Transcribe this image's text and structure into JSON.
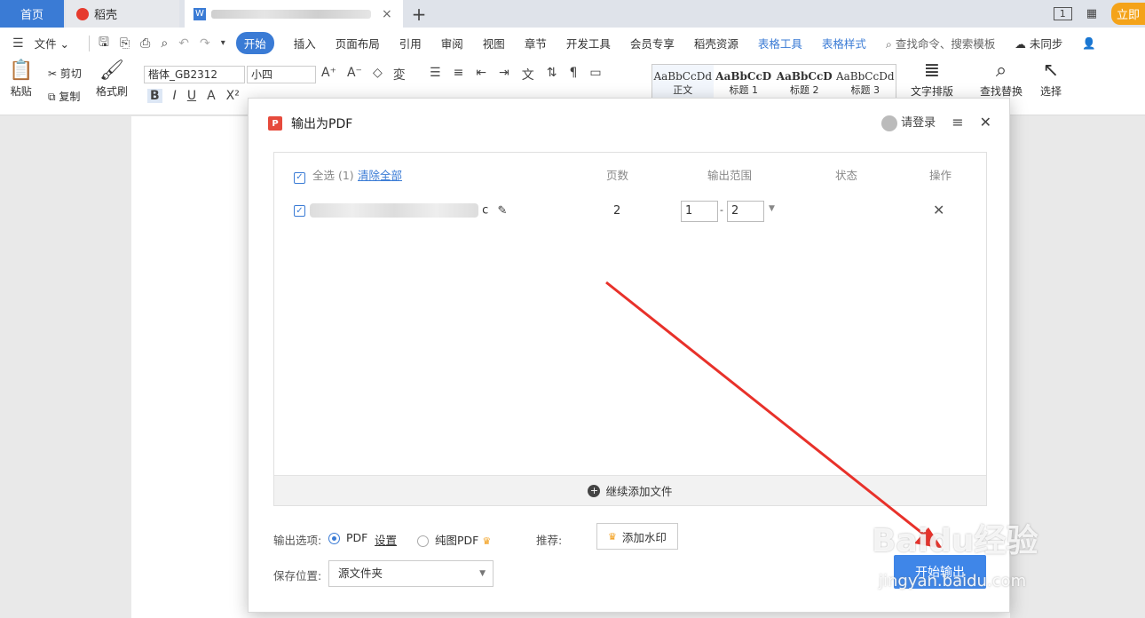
{
  "tabs": {
    "home": "首页",
    "daoke": "稻壳",
    "active_doc_close": "×",
    "plus": "+",
    "right_page_label": "1",
    "right_login_partial": "立即"
  },
  "menu": {
    "file": "文件",
    "items": [
      "开始",
      "插入",
      "页面布局",
      "引用",
      "审阅",
      "视图",
      "章节",
      "开发工具",
      "会员专享",
      "稻壳资源"
    ],
    "blue_items": [
      "表格工具",
      "表格样式"
    ],
    "search": "查找命令、搜索模板",
    "sync": "未同步"
  },
  "ribbon": {
    "paste": "粘贴",
    "cut": "剪切",
    "copy": "复制",
    "format_painter": "格式刷",
    "font_name": "楷体_GB2312",
    "font_size": "小四",
    "styles": [
      "AaBbCcDd",
      "AaBbCcD",
      "AaBbCcD",
      "AaBbCcDd"
    ],
    "style_names": [
      "正文",
      "标题 1",
      "标题 2",
      "标题 3"
    ],
    "text_layout": "文字排版",
    "find_replace": "查找替换",
    "select": "选择"
  },
  "dialog": {
    "title": "输出为PDF",
    "login": "请登录",
    "header": {
      "select_all": "全选 (1)",
      "clear_all": "清除全部",
      "pages": "页数",
      "range": "输出范围",
      "status": "状态",
      "action": "操作"
    },
    "row": {
      "name_suffix": "c",
      "pages": "2",
      "range_from": "1",
      "range_sep": "-",
      "range_to": "2"
    },
    "add_file": "继续添加文件",
    "output_options_label": "输出选项:",
    "opt_pdf": "PDF",
    "opt_settings": "设置",
    "opt_image_pdf": "纯图PDF",
    "recommend_label": "推荐:",
    "add_watermark": "添加水印",
    "save_location_label": "保存位置:",
    "save_location_value": "源文件夹",
    "start_button": "开始输出"
  },
  "watermark": {
    "brand": "Baidu经验",
    "url": "jingyan.baidu.com"
  },
  "colors": {
    "accent": "#3a7bd5",
    "start_button": "#3f86e8",
    "arrow": "#e8312a",
    "pdf_icon": "#e64a3c",
    "crown": "#f29b13"
  }
}
